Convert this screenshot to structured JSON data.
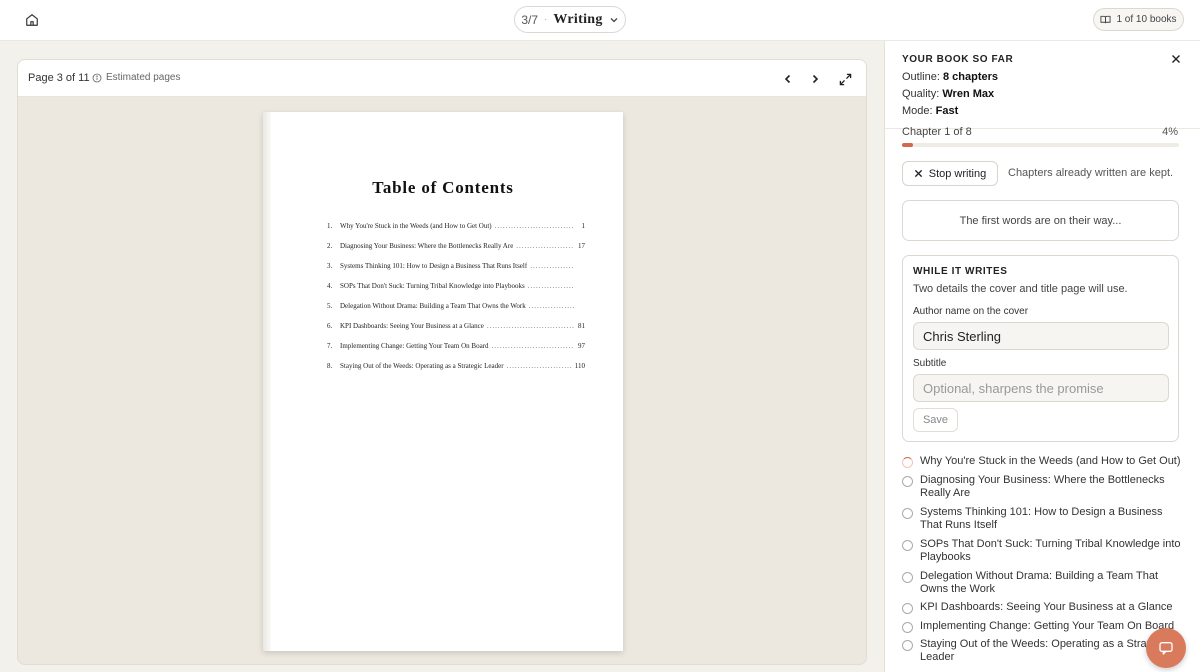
{
  "topbar": {
    "home_icon": "home-icon",
    "step": "3/7",
    "step_separator": "·",
    "step_label": "Writing",
    "books_label": "1 of 10 books",
    "book_icon": "book-icon"
  },
  "viewer": {
    "page_label": "Page 3 of 11",
    "estimated_label": "Estimated pages",
    "toc_title": "Table of Contents",
    "toc": [
      {
        "num": "1.",
        "title": "Why You're Stuck in the Weeds (and How to Get Out)",
        "page": "1"
      },
      {
        "num": "2.",
        "title": "Diagnosing Your Business: Where the Bottlenecks Really Are",
        "page": "17"
      },
      {
        "num": "3.",
        "title": "Systems Thinking 101: How to Design a Business That Runs Itself",
        "page": ""
      },
      {
        "num": "4.",
        "title": "SOPs That Don't Suck: Turning Tribal Knowledge into Playbooks",
        "page": ""
      },
      {
        "num": "5.",
        "title": "Delegation Without Drama: Building a Team That Owns the Work",
        "page": ""
      },
      {
        "num": "6.",
        "title": "KPI Dashboards: Seeing Your Business at a Glance",
        "page": "81"
      },
      {
        "num": "7.",
        "title": "Implementing Change: Getting Your Team On Board",
        "page": "97"
      },
      {
        "num": "8.",
        "title": "Staying Out of the Weeds: Operating as a Strategic Leader",
        "page": "110"
      }
    ]
  },
  "panel": {
    "title": "YOUR BOOK SO FAR",
    "outline_label": "Outline:",
    "outline_value": "8 chapters",
    "quality_label": "Quality:",
    "quality_value": "Wren Max",
    "mode_label": "Mode:",
    "mode_value": "Fast",
    "progress_label": "Chapter 1 of 8",
    "progress_pct": "4%",
    "progress_fraction": 0.04,
    "progress_color": "#d2694f",
    "stop_label": "Stop writing",
    "kept_text": "Chapters already written are kept.",
    "first_words": "The first words are on their way...",
    "while_title": "WHILE IT WRITES",
    "while_sub": "Two details the cover and title page will use.",
    "author_label": "Author name on the cover",
    "author_value": "Chris Sterling",
    "subtitle_label": "Subtitle",
    "subtitle_placeholder": "Optional, sharpens the promise",
    "save_label": "Save",
    "chapters": [
      "Why You're Stuck in the Weeds (and How to Get Out)",
      "Diagnosing Your Business: Where the Bottlenecks Really Are",
      "Systems Thinking 101: How to Design a Business That Runs Itself",
      "SOPs That Don't Suck: Turning Tribal Knowledge into Playbooks",
      "Delegation Without Drama: Building a Team That Owns the Work",
      "KPI Dashboards: Seeing Your Business at a Glance",
      "Implementing Change: Getting Your Team On Board",
      "Staying Out of the Weeds: Operating as a Strategic Leader"
    ]
  },
  "accent_color": "#d97a5c"
}
